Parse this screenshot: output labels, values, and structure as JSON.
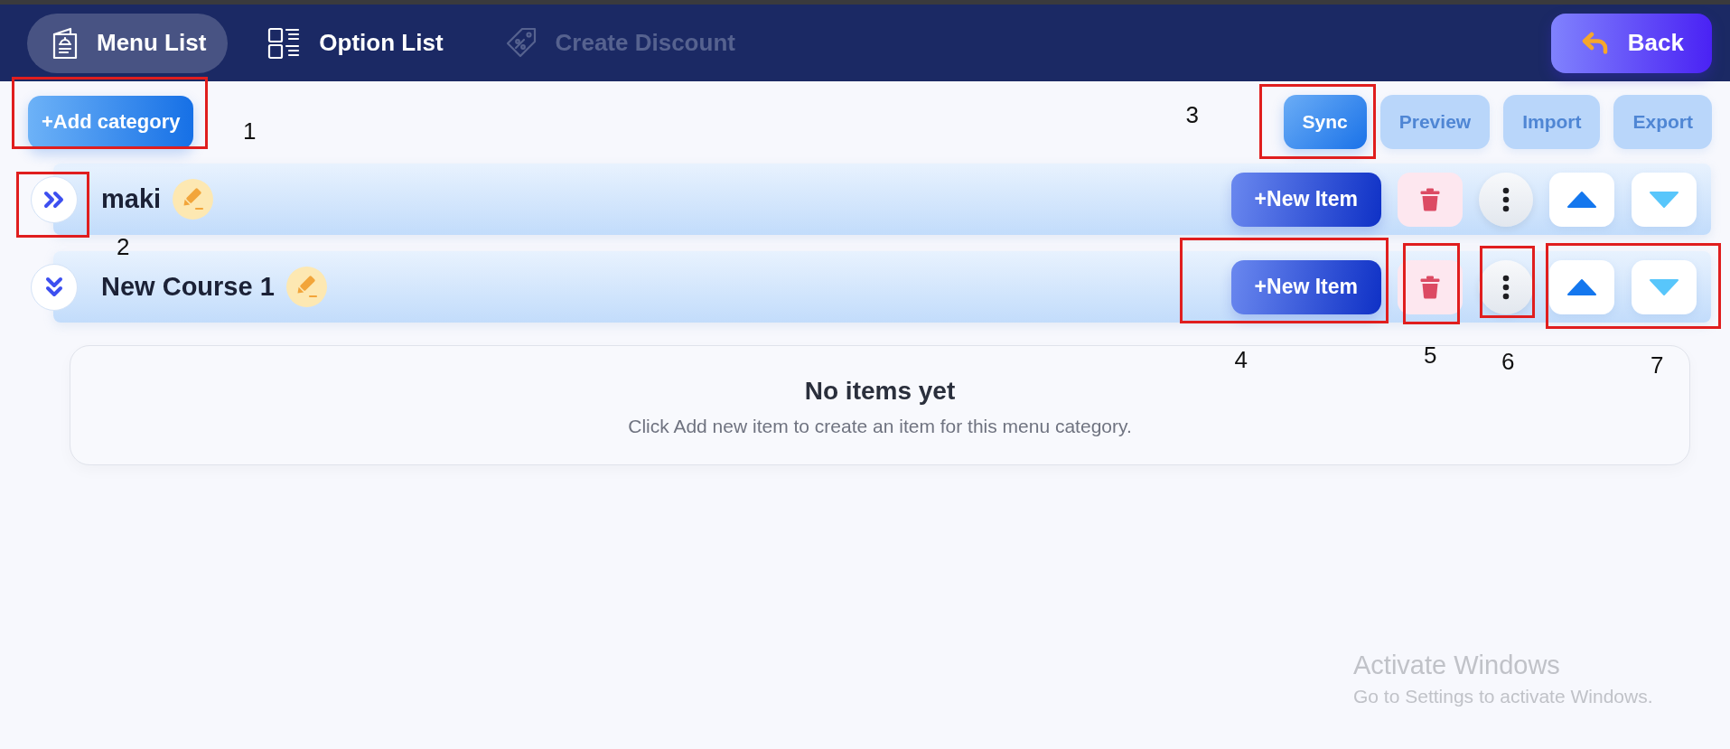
{
  "nav": {
    "tabs": [
      {
        "label": "Menu List",
        "kind": "menu",
        "selected": true,
        "disabled": false
      },
      {
        "label": "Option List",
        "kind": "options",
        "selected": false,
        "disabled": false
      },
      {
        "label": "Create Discount",
        "kind": "discount",
        "selected": false,
        "disabled": true
      }
    ],
    "back_button": {
      "label": "Back"
    }
  },
  "toolbar": {
    "add_button": {
      "label": "+Add category",
      "callout": "1"
    },
    "buttons": [
      {
        "label": "Sync",
        "disabled": false,
        "callout": "3"
      },
      {
        "label": "Preview",
        "disabled": true
      },
      {
        "label": "Import",
        "disabled": true
      },
      {
        "label": "Export",
        "disabled": true
      }
    ]
  },
  "categories": [
    {
      "name": "maki",
      "expanded": false,
      "new_item_label": "+New Item",
      "callouts": {
        "toggle": "2"
      }
    },
    {
      "name": "New Course 1",
      "expanded": true,
      "new_item_label": "+New Item",
      "callouts": {
        "new_item": "4",
        "delete": "5",
        "more": "6",
        "reorder": "7"
      },
      "empty_state": {
        "title": "No items yet",
        "message": "Click Add new item to create an item for this menu category."
      }
    }
  ],
  "activation_notice": {
    "title": "Activate Windows",
    "message": "Go to Settings to activate Windows."
  }
}
